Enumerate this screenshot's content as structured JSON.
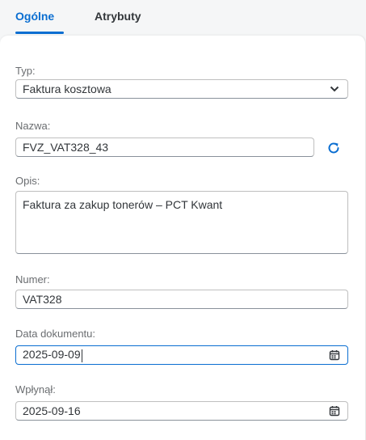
{
  "tabs": [
    {
      "label": "Ogólne",
      "active": true
    },
    {
      "label": "Atrybuty",
      "active": false
    }
  ],
  "form": {
    "type": {
      "label": "Typ:",
      "value": "Faktura kosztowa"
    },
    "name": {
      "label": "Nazwa:",
      "value": "FVZ_VAT328_43"
    },
    "description": {
      "label": "Opis:",
      "value": "Faktura za zakup tonerów – PCT Kwant"
    },
    "number": {
      "label": "Numer:",
      "value": "VAT328"
    },
    "document_date": {
      "label": "Data dokumentu:",
      "value": "2025-09-09"
    },
    "received_date": {
      "label": "Wpłynął:",
      "value": "2025-09-16"
    }
  },
  "icons": {
    "type_dropdown": "chevron-down-icon",
    "name_refresh": "refresh-icon",
    "date_picker": "calendar-icon"
  },
  "colors": {
    "accent": "#0a6ed1",
    "text": "#32363a",
    "label": "#6a6d70"
  }
}
